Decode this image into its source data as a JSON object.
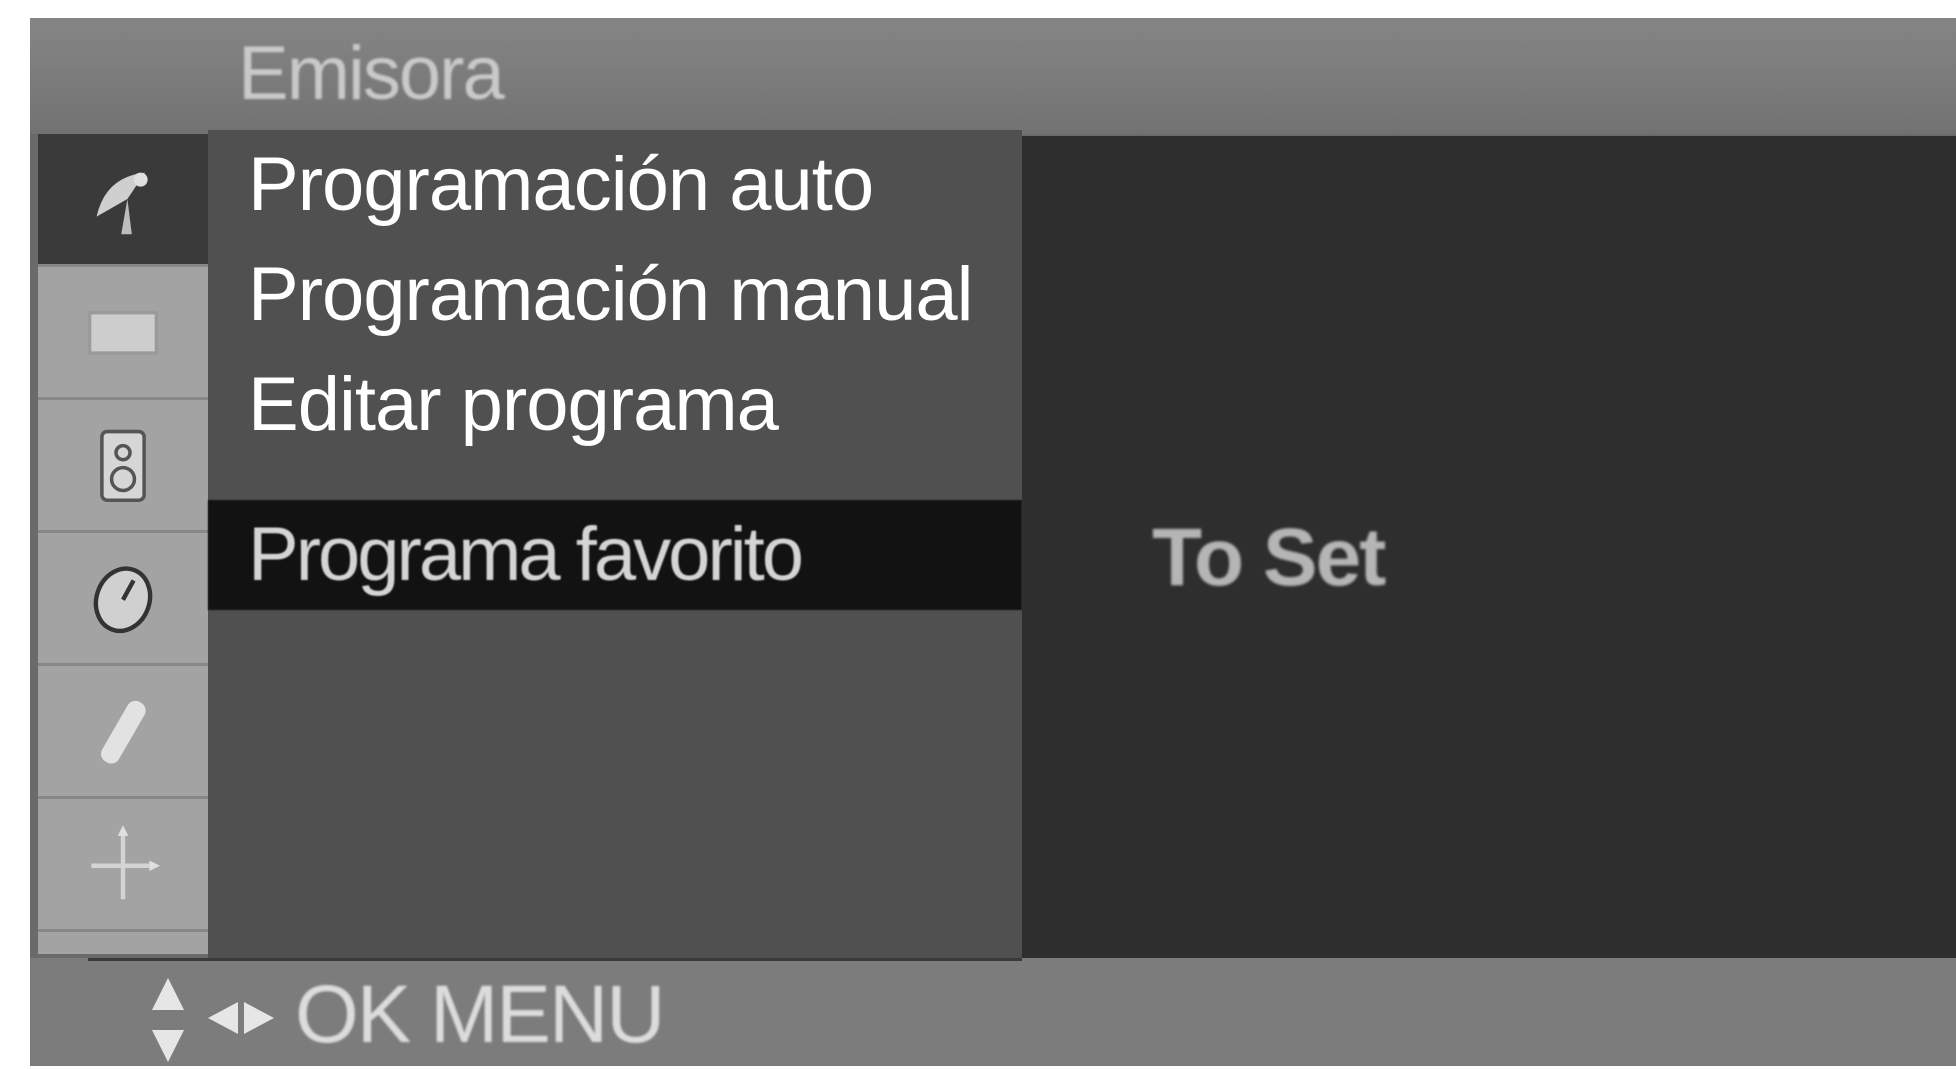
{
  "window": {
    "title": "Emisora"
  },
  "sidebar": {
    "items": [
      {
        "icon": "satellite-dish-icon",
        "active": true
      },
      {
        "icon": "picture-screen-icon",
        "active": false
      },
      {
        "icon": "audio-speaker-icon",
        "active": false
      },
      {
        "icon": "clock-icon",
        "active": false
      },
      {
        "icon": "special-tool-icon",
        "active": false
      },
      {
        "icon": "screen-adjust-icon",
        "active": false
      }
    ]
  },
  "menu": {
    "items": [
      {
        "label": "Programación auto"
      },
      {
        "label": "Programación manual"
      },
      {
        "label": "Editar programa"
      },
      {
        "label": "Programa favorito",
        "selected": true
      }
    ]
  },
  "submenu": {
    "value": "To Set"
  },
  "footer": {
    "nav_icons": [
      "up-down-arrows-icon",
      "left-right-arrows-icon"
    ],
    "ok_label": "OK",
    "menu_label": "MENU"
  },
  "colors": {
    "title_bar": "#7a7a7a",
    "sidebar": "#a3a3a3",
    "menu_panel": "#505050",
    "selected_row": "#121212",
    "submenu_panel": "#2e2e2e"
  }
}
